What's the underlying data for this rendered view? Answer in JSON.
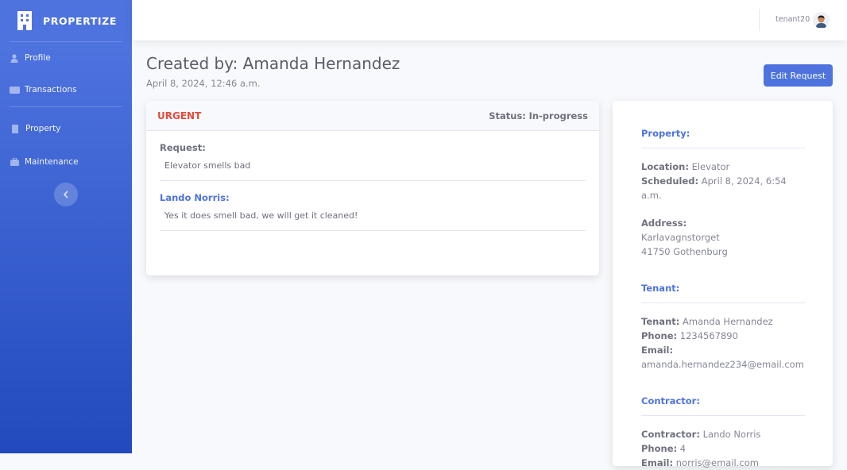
{
  "brand": {
    "name": "PROPERTIZE"
  },
  "sidebar": {
    "items": [
      {
        "label": "Profile",
        "icon": "user-icon"
      },
      {
        "label": "Transactions",
        "icon": "card-icon"
      },
      {
        "label": "Property",
        "icon": "building-icon"
      },
      {
        "label": "Maintenance",
        "icon": "toolbox-icon"
      }
    ]
  },
  "topbar": {
    "username": "tenant20"
  },
  "header": {
    "title": "Created by: Amanda Hernandez",
    "date": "April 8, 2024, 12:46 a.m.",
    "edit_label": "Edit Request"
  },
  "request": {
    "priority": "URGENT",
    "status_label": "Status:",
    "status_value": "In-progress",
    "request_label": "Request:",
    "request_text": "Elevator smells bad",
    "reply_author": "Lando Norris:",
    "reply_text": "Yes it does smell bad, we will get it cleaned!"
  },
  "details": {
    "property": {
      "title": "Property:",
      "location_label": "Location:",
      "location": "Elevator",
      "scheduled_label": "Scheduled:",
      "scheduled": "April 8, 2024, 6:54 a.m.",
      "address_label": "Address:",
      "address_line1": "Karlavagnstorget",
      "address_line2": "41750 Gothenburg"
    },
    "tenant": {
      "title": "Tenant:",
      "name_label": "Tenant:",
      "name": "Amanda Hernandez",
      "phone_label": "Phone:",
      "phone": "1234567890",
      "email_label": "Email:",
      "email": "amanda.hernandez234@email.com"
    },
    "contractor": {
      "title": "Contractor:",
      "name_label": "Contractor:",
      "name": "Lando Norris",
      "phone_label": "Phone:",
      "phone": "4",
      "email_label": "Email:",
      "email": "norris@email.com"
    }
  },
  "colors": {
    "primary": "#4e73df",
    "urgent": "#e74a3b",
    "text": "#858796"
  }
}
